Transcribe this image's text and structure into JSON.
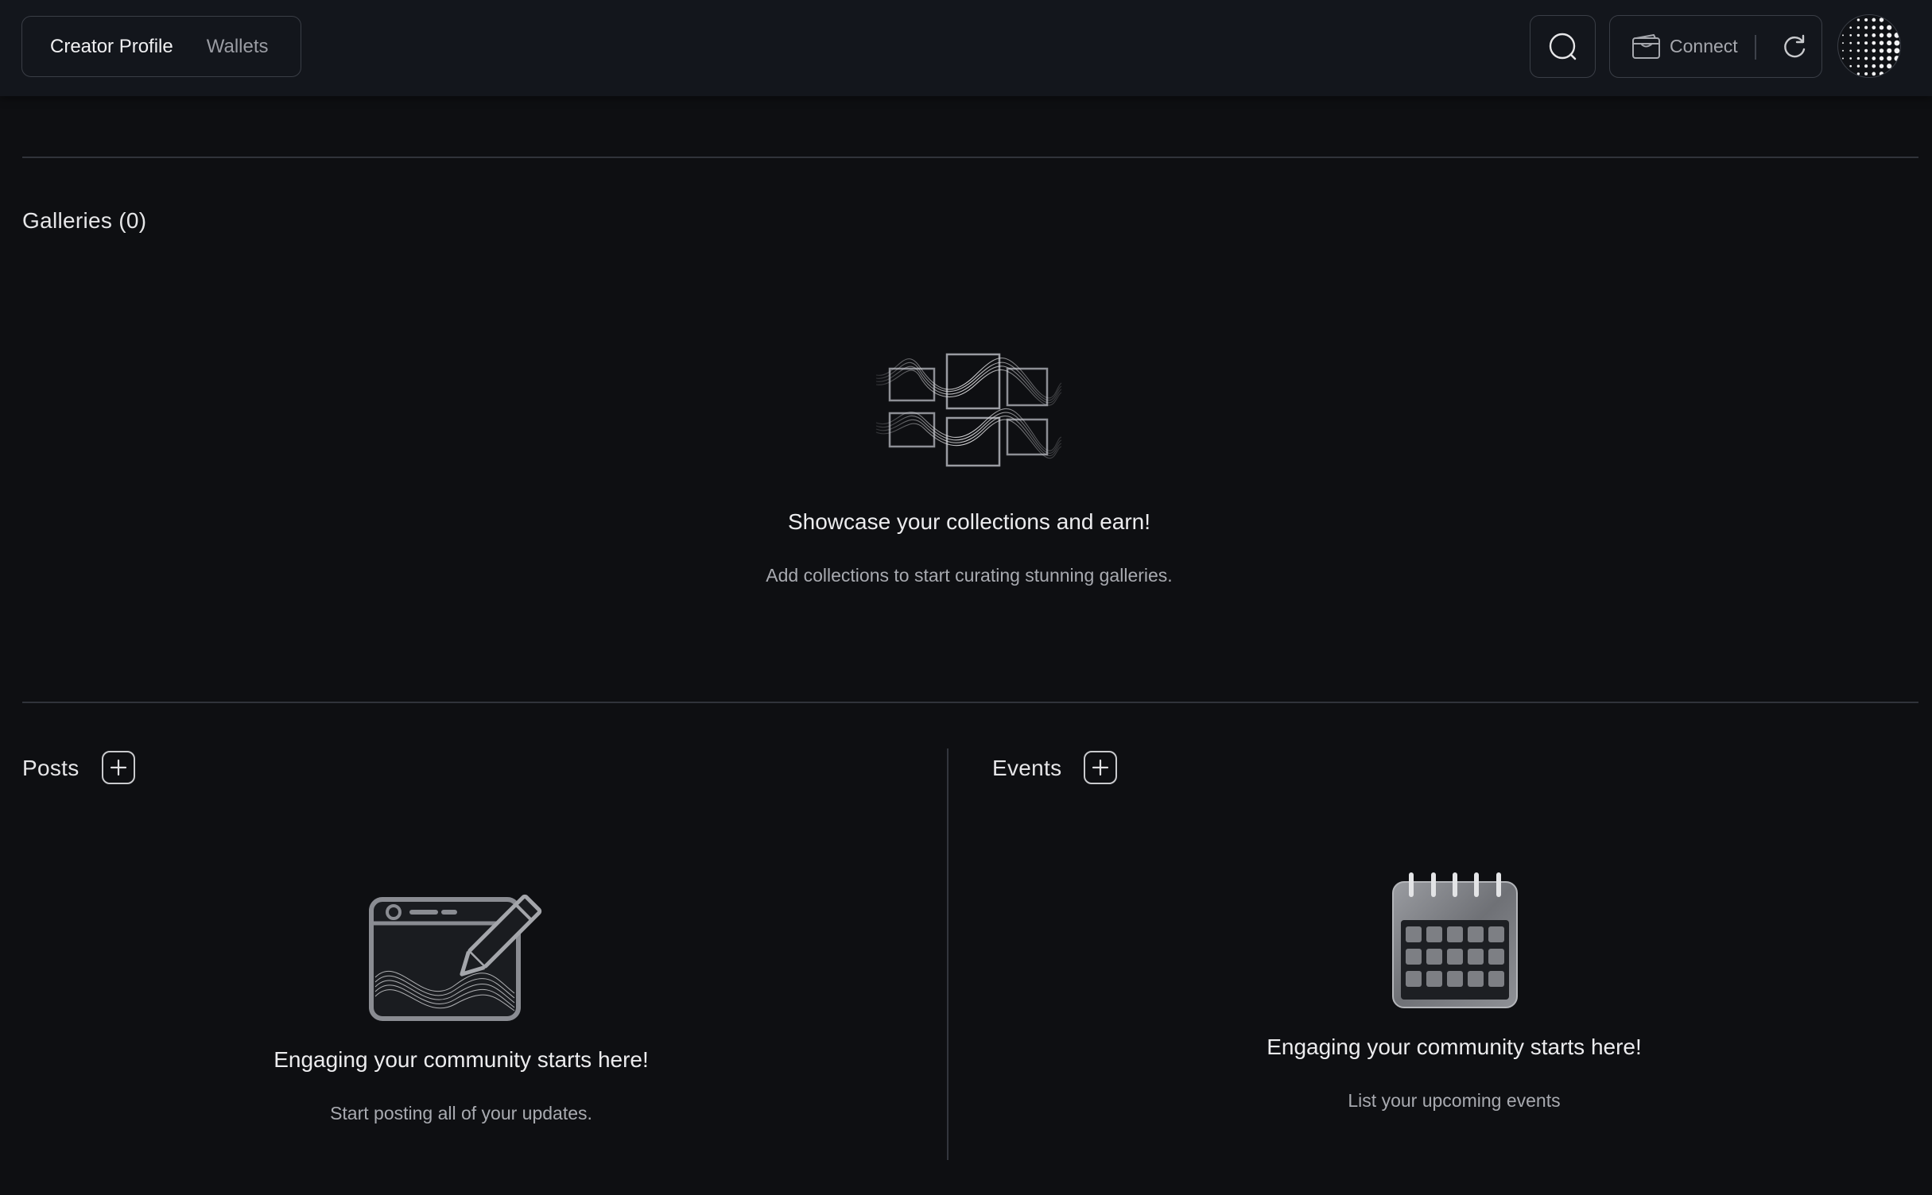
{
  "header": {
    "tabs": [
      {
        "label": "Creator Profile",
        "active": true
      },
      {
        "label": "Wallets",
        "active": false
      }
    ],
    "search_icon": "search-icon",
    "connect_label": "Connect",
    "connect_icon": "wallet-icon",
    "refresh_icon": "refresh-icon",
    "avatar_icon": "dotted-avatar"
  },
  "galleries": {
    "title": "Galleries (0)",
    "empty_title": "Showcase your collections and earn!",
    "empty_subtitle": "Add collections to start curating stunning galleries."
  },
  "posts": {
    "title": "Posts",
    "add_icon": "plus-icon",
    "empty_title": "Engaging your community starts here!",
    "empty_subtitle": "Start posting all of your updates."
  },
  "events": {
    "title": "Events",
    "add_icon": "plus-icon",
    "empty_title": "Engaging your community starts here!",
    "empty_subtitle": "List your upcoming events"
  },
  "colors": {
    "background": "#0e0f12",
    "topbar": "#13161c",
    "border": "#3a3e46",
    "text_primary": "#ececee",
    "text_secondary": "#a8aab0"
  }
}
